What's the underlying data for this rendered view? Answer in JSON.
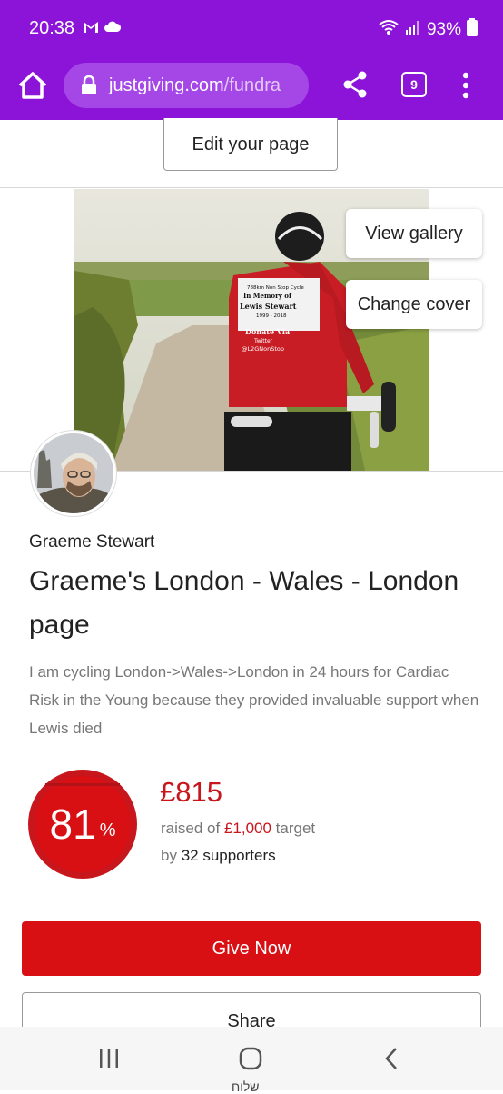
{
  "status": {
    "time": "20:38",
    "battery": "93%",
    "icons": [
      "gmail-icon",
      "cloud-icon",
      "wifi-icon",
      "signal-icon",
      "battery-icon"
    ]
  },
  "browser": {
    "url_domain": "justgiving.com",
    "url_path": "/fundra",
    "tab_count": "9",
    "icons": [
      "home-icon",
      "lock-icon",
      "share-icon",
      "kebab-menu-icon"
    ],
    "theme_color": "#8c13d8"
  },
  "page": {
    "edit_button": "Edit your page",
    "view_gallery": "View gallery",
    "change_cover": "Change cover",
    "jersey_text": [
      "788km Non Stop Cycle",
      "In Memory of",
      "Lewis Stewart",
      "1999 - 2018",
      "Donate Via",
      "Twitter",
      "@L2GNonStop"
    ],
    "owner_name": "Graeme Stewart",
    "title": "Graeme's London - Wales - London page",
    "description": "I am cycling London->Wales->London in 24 hours for Cardiac Risk in the Young because they provided invaluable support when Lewis died",
    "progress": {
      "percent_value": "81",
      "percent_sign": "%",
      "fraction": 0.815,
      "raised": "£815",
      "raised_prefix": "raised of ",
      "target": "£1,000",
      "target_suffix": " target",
      "supporters_prefix": "by ",
      "supporters": "32 supporters"
    },
    "give_now": "Give Now",
    "share": "Share",
    "brand_red": "#d80f13"
  },
  "navbar": {
    "icons": [
      "recent-apps-icon",
      "home-circle-icon",
      "back-icon"
    ],
    "peek_text": "שלוח"
  }
}
